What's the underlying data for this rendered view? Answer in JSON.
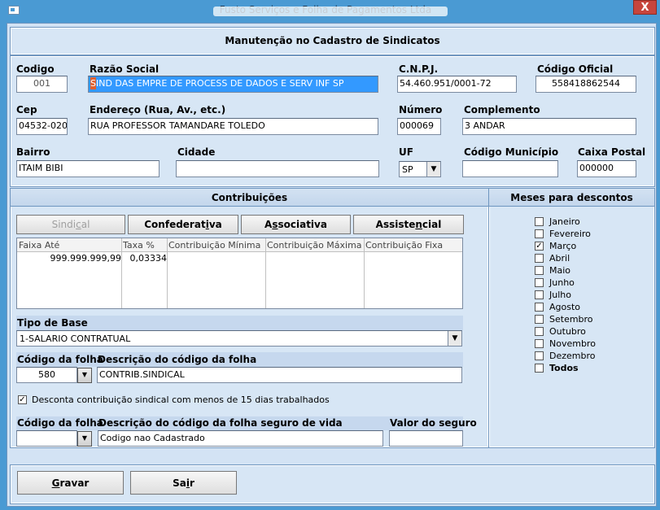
{
  "window": {
    "title": "Fusto Serviços e Folha de Pagamentos Ltda",
    "close_label": "X"
  },
  "form": {
    "header": "Manutenção no Cadastro de Sindicatos",
    "codigo": {
      "label": "Codigo",
      "value": "001"
    },
    "razao_social": {
      "label": "Razão Social",
      "cursor_char": "S",
      "value": "IND DAS EMPRE DE PROCESS DE DADOS E SERV INF SP"
    },
    "cnpj": {
      "label": "C.N.P.J.",
      "value": "54.460.951/0001-72"
    },
    "codigo_oficial": {
      "label": "Código Oficial",
      "value": "558418862544"
    },
    "cep": {
      "label": "Cep",
      "value": "04532-020"
    },
    "endereco": {
      "label": "Endereço (Rua, Av., etc.)",
      "value": "RUA PROFESSOR TAMANDARE TOLEDO"
    },
    "numero": {
      "label": "Número",
      "value": "000069"
    },
    "complemento": {
      "label": "Complemento",
      "value": "3 ANDAR"
    },
    "bairro": {
      "label": "Bairro",
      "value": "ITAIM BIBI"
    },
    "cidade": {
      "label": "Cidade",
      "value": ""
    },
    "uf": {
      "label": "UF",
      "value": "SP"
    },
    "codigo_municipio": {
      "label": "Código Município",
      "value": ""
    },
    "caixa_postal": {
      "label": "Caixa Postal",
      "value": "000000"
    }
  },
  "contribuicoes": {
    "header": "Contribuições",
    "tabs": [
      {
        "pre": "Sindi",
        "u": "c",
        "post": "al",
        "disabled": true
      },
      {
        "pre": "Confederat",
        "u": "i",
        "post": "va",
        "disabled": false
      },
      {
        "pre": "A",
        "u": "s",
        "post": "sociativa",
        "disabled": false
      },
      {
        "pre": "Assiste",
        "u": "n",
        "post": "cial",
        "disabled": false
      }
    ],
    "grid": {
      "columns": [
        "Faixa Até",
        "Taxa %",
        "Contribuição Mínima",
        "Contribuição Máxima",
        "Contribuição Fixa"
      ],
      "rows": [
        {
          "faixa": "999.999.999,99",
          "taxa": "0,03334",
          "minima": "",
          "maxima": "",
          "fixa": ""
        }
      ]
    },
    "tipo_base": {
      "label": "Tipo de Base",
      "value": "1-SALARIO CONTRATUAL"
    },
    "codigo_folha": {
      "label": "Código da folha",
      "value": "580"
    },
    "descricao_folha": {
      "label": "Descrição do código da folha",
      "value": "CONTRIB.SINDICAL"
    },
    "desconta": {
      "label": "Desconta contribuição sindical com menos de 15 dias trabalhados",
      "checked": true
    },
    "codigo_folha_seguro": {
      "label": "Código da folha",
      "value": ""
    },
    "descricao_seguro": {
      "label": "Descrição do código da folha seguro de vida",
      "value": "Codigo nao Cadastrado"
    },
    "valor_seguro": {
      "label": "Valor do seguro",
      "value": ""
    }
  },
  "meses": {
    "header": "Meses para descontos",
    "items": [
      {
        "label": "Janeiro",
        "checked": false
      },
      {
        "label": "Fevereiro",
        "checked": false
      },
      {
        "label": "Março",
        "checked": true
      },
      {
        "label": "Abril",
        "checked": false
      },
      {
        "label": "Maio",
        "checked": false
      },
      {
        "label": "Junho",
        "checked": false
      },
      {
        "label": "Julho",
        "checked": false
      },
      {
        "label": "Agosto",
        "checked": false
      },
      {
        "label": "Setembro",
        "checked": false
      },
      {
        "label": "Outubro",
        "checked": false
      },
      {
        "label": "Novembro",
        "checked": false
      },
      {
        "label": "Dezembro",
        "checked": false
      }
    ],
    "todos": {
      "label": "Todos",
      "checked": false
    }
  },
  "footer": {
    "gravar": {
      "u": "G",
      "post": "ravar"
    },
    "sair": {
      "pre": "Sa",
      "u": "i",
      "post": "r"
    }
  },
  "icons": {
    "dropdown": "chevron-down-icon",
    "check": "checkmark-icon"
  }
}
